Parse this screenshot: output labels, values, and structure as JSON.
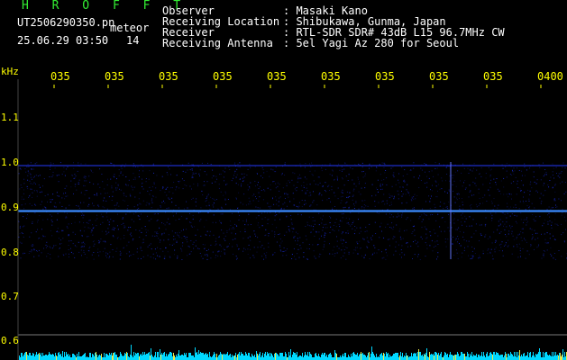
{
  "header": {
    "title": "H R O F F T",
    "filename": "UT2506290350.pn",
    "datetime": "25.06.29 03:50",
    "meteor_label": "meteor",
    "meteor_count": "14"
  },
  "info": [
    {
      "key": "Observer",
      "value": ": Masaki Kano"
    },
    {
      "key": "Receiving Location",
      "value": ": Shibukawa, Gunma, Japan"
    },
    {
      "key": "Receiver",
      "value": ": RTL-SDR SDR# 43dB L15 96.7MHz CW"
    },
    {
      "key": "Receiving Antenna",
      "value": ": 5el Yagi Az 280 for Seoul"
    }
  ],
  "axis": {
    "unit": "kHz",
    "time_ticks": [
      "035",
      "035",
      "035",
      "035",
      "035",
      "035",
      "035",
      "035",
      "035",
      "0400"
    ],
    "freq_ticks": [
      "1.1",
      "1.0",
      "0.9",
      "0.8",
      "0.7",
      "0.6"
    ]
  },
  "colors": {
    "label": "#ffff00",
    "title": "#33ee33",
    "signal": "#2233ff",
    "carrier": "#3399ff",
    "noise_floor": "#00e0ff",
    "meteor": "#ffffff"
  }
}
